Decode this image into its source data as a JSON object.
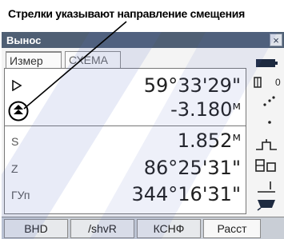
{
  "callout": {
    "text": "Стрелки указывают направление смещения"
  },
  "window": {
    "title": "Вынос",
    "close_glyph": "×"
  },
  "tabs": [
    {
      "label": "Измер"
    },
    {
      "label": "СХЕМА"
    }
  ],
  "rows": [
    {
      "label": "",
      "value": "59°33'29\"",
      "unit": ""
    },
    {
      "label": "",
      "value": "-3.180",
      "unit": "м"
    },
    {
      "label": "S",
      "value": "1.852",
      "unit": "м"
    },
    {
      "label": "Z",
      "value": "86°25'31\"",
      "unit": ""
    },
    {
      "label": "ГУп",
      "value": "344°16'31\"",
      "unit": ""
    }
  ],
  "side": {
    "indicator_value": "0"
  },
  "softkeys": [
    {
      "label": "ВНD"
    },
    {
      "label": "/shvR"
    },
    {
      "label": "КСНФ"
    },
    {
      "label": "Расст"
    }
  ],
  "colors": {
    "titlebar": "#4f5f74",
    "watermark": "#5a6ec8",
    "softkey_bar": "#c9ced6"
  }
}
